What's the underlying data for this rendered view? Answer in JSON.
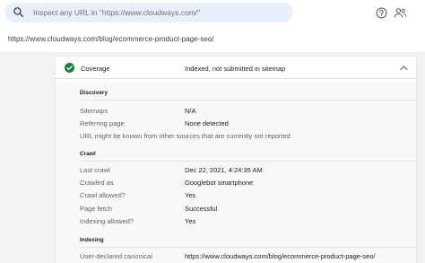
{
  "search": {
    "placeholder": "Inspect any URL in \"https://www.cloudways.com/\""
  },
  "header_icons": [
    "help-icon",
    "people-icon",
    "search-icon"
  ],
  "inspected_url": "https://www.cloudways.com/blog/ecommerce-product-page-seo/",
  "coverage": {
    "label": "Coverage",
    "status": "Indexed, not submitted in sitemap",
    "status_icon": "check-circle-icon",
    "status_color": "#188038",
    "expand_icon": "chevron-up-icon"
  },
  "discovery": {
    "title": "Discovery",
    "rows": [
      {
        "label": "Sitemaps",
        "value": "N/A"
      },
      {
        "label": "Referring page",
        "value": "None detected"
      }
    ],
    "note": "URL might be known from other sources that are currently not reported"
  },
  "crawl": {
    "title": "Crawl",
    "rows": [
      {
        "label": "Last crawl",
        "value": "Dec 22, 2021, 4:24:35 AM"
      },
      {
        "label": "Crawled as",
        "value": "Googlebot smartphone"
      },
      {
        "label": "Crawl allowed?",
        "value": "Yes"
      },
      {
        "label": "Page fetch",
        "value": "Successful"
      },
      {
        "label": "Indexing allowed?",
        "value": "Yes"
      }
    ]
  },
  "indexing": {
    "title": "Indexing",
    "rows": [
      {
        "label": "User-declared canonical",
        "value": "https://www.cloudways.com/blog/ecommerce-product-page-seo/"
      }
    ]
  }
}
